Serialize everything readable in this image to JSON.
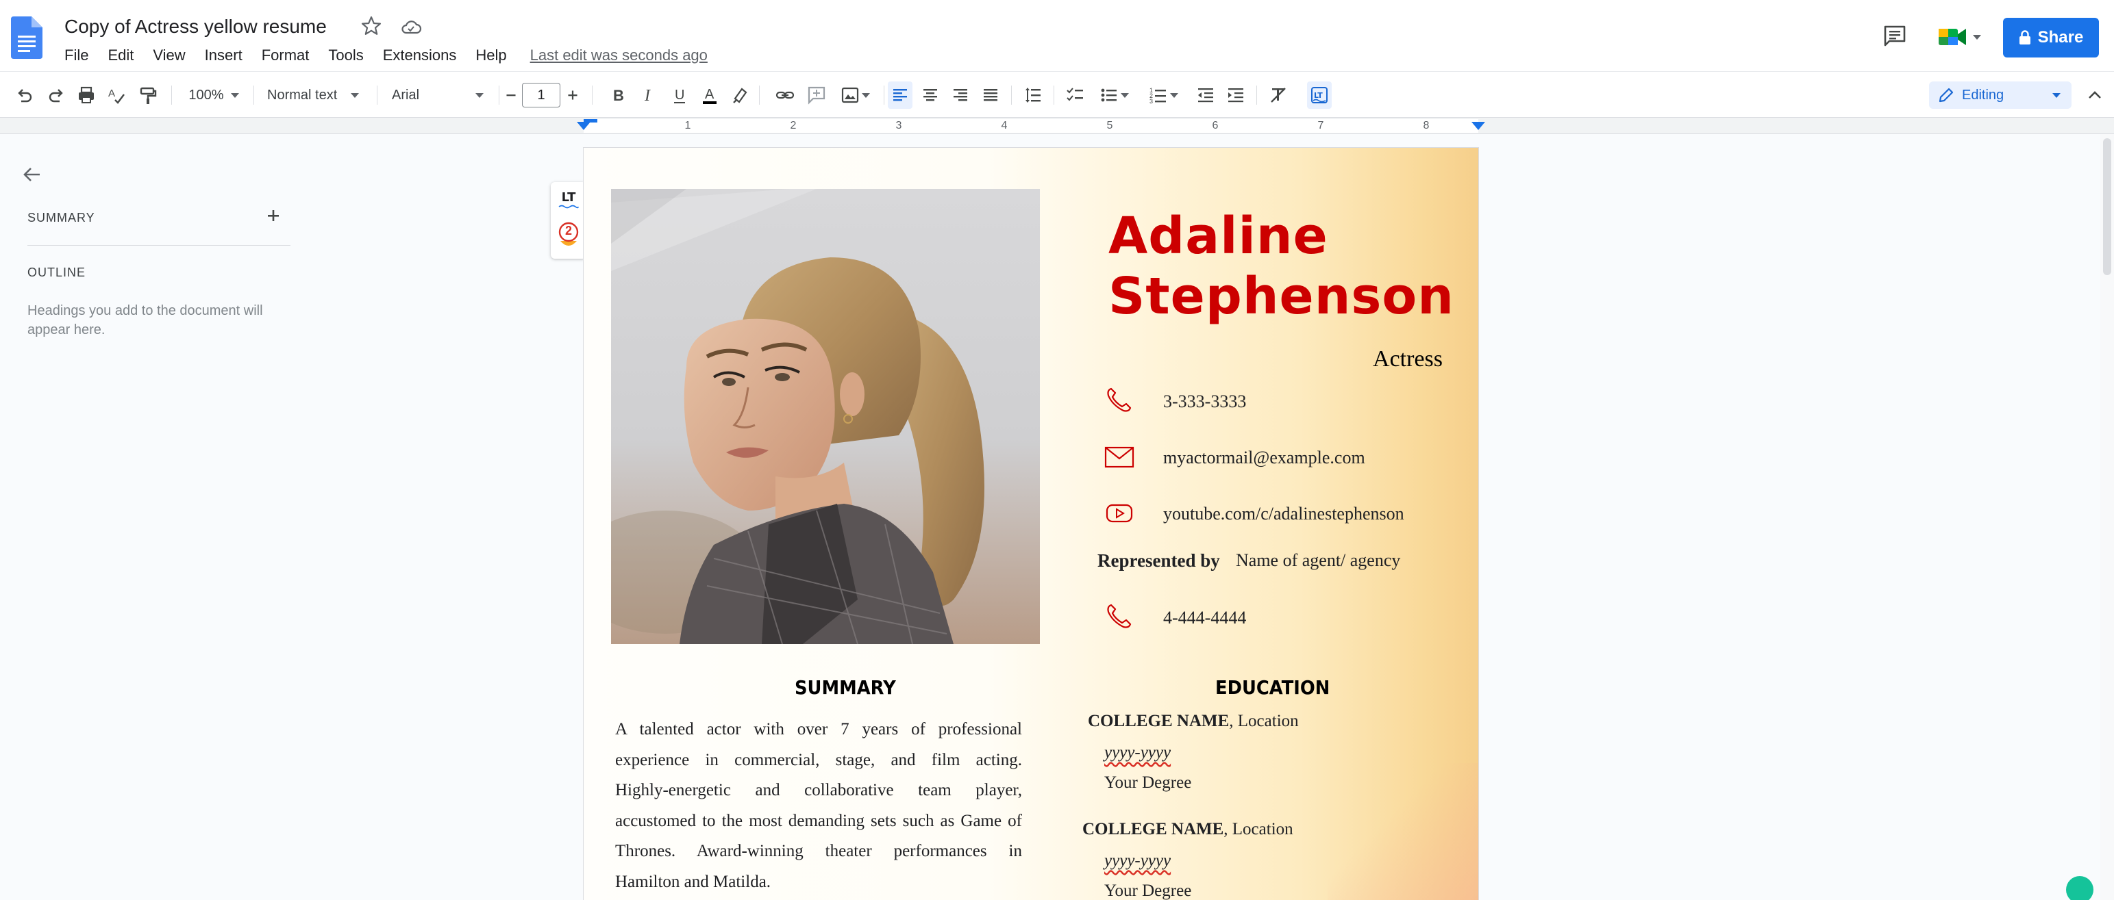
{
  "header": {
    "doc_title": "Copy of Actress yellow resume",
    "last_edit": "Last edit was seconds ago",
    "share_label": "Share",
    "menu": [
      "File",
      "Edit",
      "View",
      "Insert",
      "Format",
      "Tools",
      "Extensions",
      "Help"
    ]
  },
  "toolbar": {
    "zoom": "100%",
    "style": "Normal text",
    "font": "Arial",
    "font_size": "1",
    "mode": "Editing",
    "icons": [
      "undo-icon",
      "redo-icon",
      "print-icon",
      "spellcheck-icon",
      "paint-format-icon",
      "bold-icon",
      "italic-icon",
      "underline-icon",
      "text-color-icon",
      "highlight-icon",
      "link-icon",
      "comment-add-icon",
      "image-icon",
      "align-left-icon",
      "align-center-icon",
      "align-right-icon",
      "justify-icon",
      "line-spacing-icon",
      "checklist-icon",
      "bullet-list-icon",
      "numbered-list-icon",
      "decrease-indent-icon",
      "increase-indent-icon",
      "clear-format-icon",
      "languagetool-icon"
    ],
    "accent_color": "#1a73e8"
  },
  "ruler": {
    "numbers": [
      "1",
      "2",
      "3",
      "4",
      "5",
      "6",
      "7",
      "8"
    ]
  },
  "outline": {
    "summary_label": "SUMMARY",
    "outline_label": "OUTLINE",
    "hint": "Headings you add to the document will appear here."
  },
  "languagetool": {
    "logo": "LT",
    "error_count": "2"
  },
  "resume": {
    "first_name": "Adaline",
    "last_name": "Stephenson",
    "role": "Actress",
    "name_color": "#cc0000",
    "phone": "3-333-3333",
    "email": "myactormail@example.com",
    "youtube": "youtube.com/c/adalinestephenson",
    "represented_label": "Represented by",
    "represented_value": "Name of agent/ agency",
    "agent_phone": "4-444-4444",
    "summary_title": "SUMMARY",
    "summary_lines": [
      "A talented actor with over 7 years of professional",
      "experience in commercial, stage, and film acting.",
      "Highly-energetic and collaborative team player,",
      "accustomed to the most demanding sets such as Game of",
      "Thrones. Award-winning theater performances in",
      "Hamilton and Matilda."
    ],
    "education_title": "EDUCATION",
    "education": [
      {
        "college": "COLLEGE NAME",
        "location": ", Location",
        "date": "yyyy-yyyy",
        "degree": "Your Degree"
      },
      {
        "college": "COLLEGE NAME",
        "location": ", Location",
        "date": "yyyy-yyyy",
        "degree": "Your Degree"
      }
    ]
  }
}
